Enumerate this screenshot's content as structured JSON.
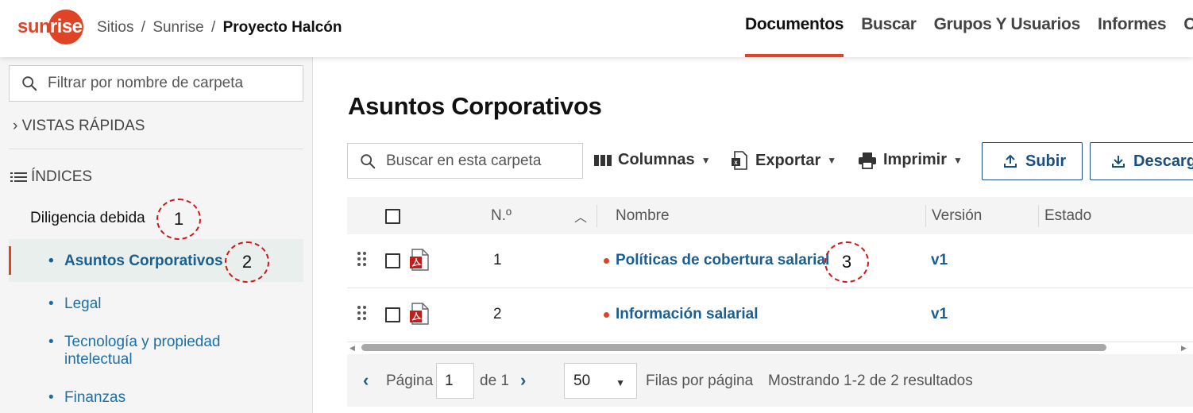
{
  "header": {
    "logo_left": "sun",
    "logo_right": "rise",
    "breadcrumb": [
      "Sitios",
      "Sunrise"
    ],
    "breadcrumb_sep": "/",
    "breadcrumb_current": "Proyecto Halcón",
    "nav": [
      "Documentos",
      "Buscar",
      "Grupos Y Usuarios",
      "Informes",
      "C"
    ],
    "active_nav": "Documentos",
    "accent_color": "#e04427"
  },
  "sidebar": {
    "filter_placeholder": "Filtrar por nombre de carpeta",
    "quick_views": "VISTAS RÁPIDAS",
    "indices": "ÍNDICES",
    "parent": "Diligencia debida",
    "items": [
      {
        "label": "Asuntos Corporativos",
        "selected": true
      },
      {
        "label": "Legal"
      },
      {
        "label": "Tecnología y propiedad intelectual"
      },
      {
        "label": "Finanzas"
      }
    ]
  },
  "markers": [
    "1",
    "2",
    "3"
  ],
  "main": {
    "title": "Asuntos Corporativos",
    "search_placeholder": "Buscar en esta carpeta",
    "toolbar": {
      "columns": "Columnas",
      "export": "Exportar",
      "print": "Imprimir",
      "upload": "Subir",
      "download": "Descarg"
    },
    "table": {
      "headers": {
        "num": "N.º",
        "name": "Nombre",
        "version": "Versión",
        "status": "Estado"
      },
      "rows": [
        {
          "num": "1",
          "name": "Políticas de cobertura salarial",
          "version": "v1",
          "icon": "pdf-icon"
        },
        {
          "num": "2",
          "name": "Información salarial",
          "version": "v1",
          "icon": "pdf-icon"
        }
      ]
    },
    "pager": {
      "page_label": "Página",
      "page_value": "1",
      "of_label": "de 1",
      "rows_value": "50",
      "rows_label": "Filas por página",
      "showing": "Mostrando 1-2 de 2 resultados"
    }
  }
}
